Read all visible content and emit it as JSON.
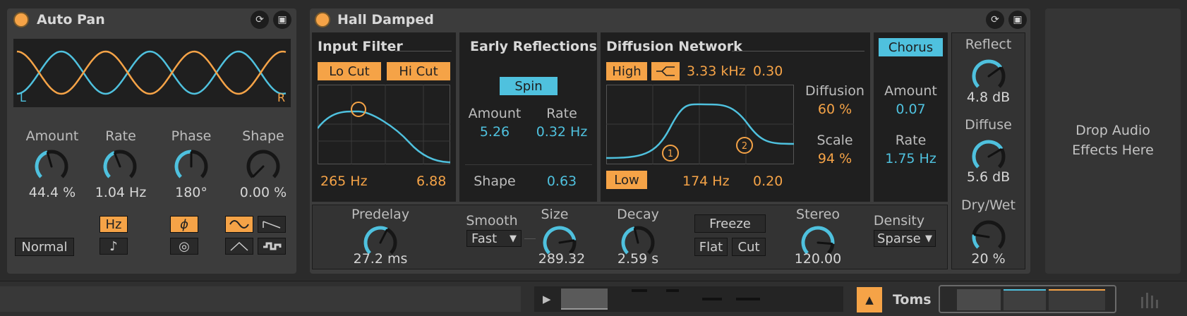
{
  "auto_pan": {
    "title": "Auto Pan",
    "lfo": {
      "left_label": "L",
      "right_label": "R"
    },
    "knobs": {
      "amount": {
        "label": "Amount",
        "value": "44.4 %",
        "level": 0.44
      },
      "rate": {
        "label": "Rate",
        "value": "1.04 Hz",
        "level": 0.42
      },
      "phase": {
        "label": "Phase",
        "value": "180°",
        "level": 0.5
      },
      "shape": {
        "label": "Shape",
        "value": "0.00 %",
        "level": 0.0
      }
    },
    "mode": "Normal",
    "rate_mode": {
      "hz": "Hz",
      "note": "♪"
    },
    "phase_mode": {
      "phase": "ϕ",
      "spin": "◎"
    }
  },
  "hall": {
    "title": "Hall Damped",
    "input_filter": {
      "title": "Input Filter",
      "lo_cut": "Lo Cut",
      "hi_cut": "Hi Cut",
      "freq": "265 Hz",
      "q": "6.88"
    },
    "early": {
      "title": "Early Reflections",
      "spin": "Spin",
      "amount_label": "Amount",
      "amount_value": "5.26",
      "rate_label": "Rate",
      "rate_value": "0.32 Hz",
      "shape_label": "Shape",
      "shape_value": "0.63"
    },
    "diffusion_network": {
      "title": "Diffusion Network",
      "high": "High",
      "high_freq": "3.33 kHz",
      "high_val": "0.30",
      "low": "Low",
      "low_freq": "174 Hz",
      "low_val": "0.20",
      "diffusion_label": "Diffusion",
      "diffusion_value": "60 %",
      "scale_label": "Scale",
      "scale_value": "94 %",
      "marker1": "1",
      "marker2": "2"
    },
    "chorus": {
      "title": "Chorus",
      "amount_label": "Amount",
      "amount_value": "0.07",
      "rate_label": "Rate",
      "rate_value": "1.75 Hz"
    },
    "bottom": {
      "predelay": {
        "label": "Predelay",
        "value": "27.2 ms",
        "level": 0.6
      },
      "smooth_label": "Smooth",
      "smooth_value": "Fast",
      "size": {
        "label": "Size",
        "value": "289.32",
        "level": 0.8
      },
      "decay": {
        "label": "Decay",
        "value": "2.59 s",
        "level": 0.45
      },
      "freeze": "Freeze",
      "flat": "Flat",
      "cut": "Cut",
      "stereo": {
        "label": "Stereo",
        "value": "120.00",
        "level": 0.85
      },
      "density_label": "Density",
      "density_value": "Sparse"
    },
    "right": {
      "reflect": {
        "label": "Reflect",
        "value": "4.8 dB",
        "level": 0.7
      },
      "diffuse": {
        "label": "Diffuse",
        "value": "5.6 dB",
        "level": 0.72
      },
      "drywet": {
        "label": "Dry/Wet",
        "value": "20 %",
        "level": 0.2
      }
    }
  },
  "drop_area": {
    "line1": "Drop Audio",
    "line2": "Effects Here"
  },
  "bottom_bar": {
    "track_name": "Toms"
  },
  "colors": {
    "orange": "#f5a347",
    "blue": "#4fc1de"
  }
}
